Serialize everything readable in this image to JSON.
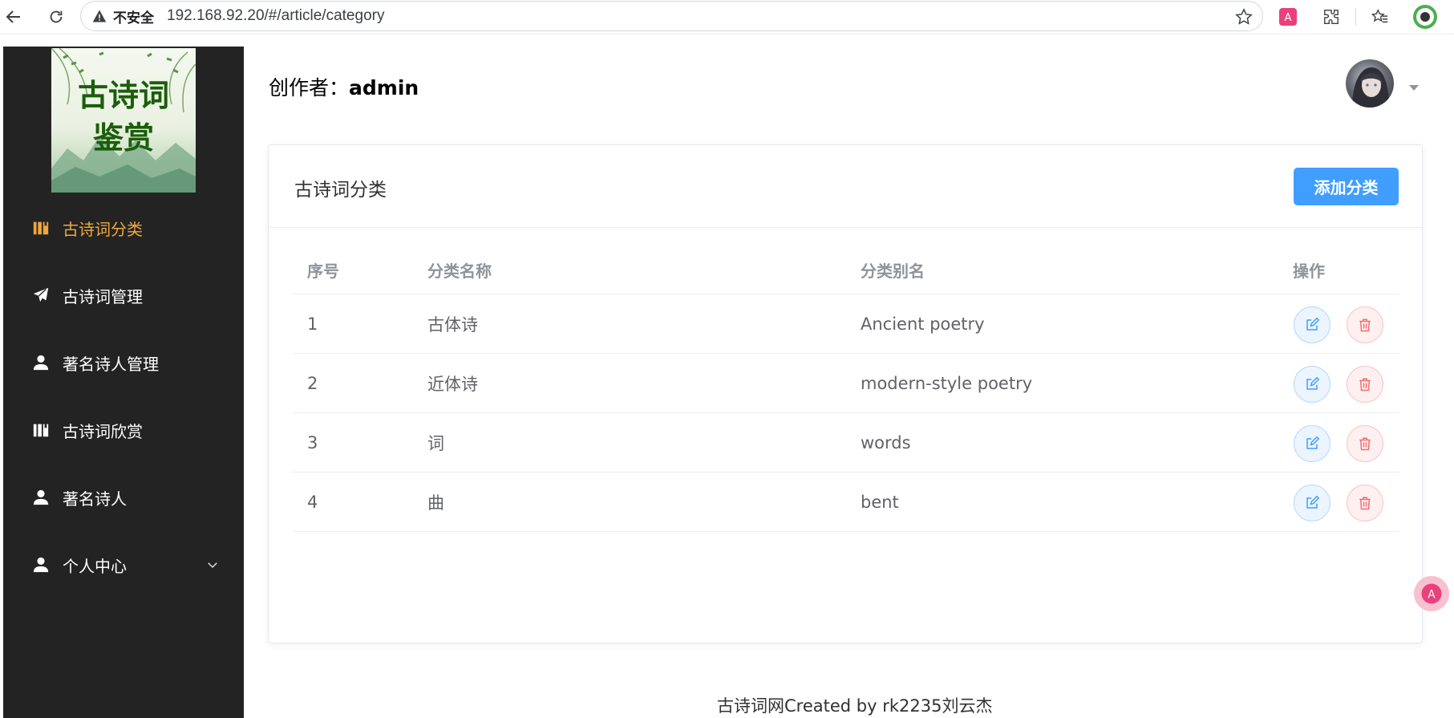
{
  "browser": {
    "insecure_label": "不安全",
    "url": "192.168.92.20/#/article/category"
  },
  "sidebar": {
    "logo_text": "古诗词鉴赏",
    "items": [
      {
        "label": "古诗词分类",
        "icon": "book-icon",
        "active": true
      },
      {
        "label": "古诗词管理",
        "icon": "paper-plane-icon"
      },
      {
        "label": "著名诗人管理",
        "icon": "user-icon"
      },
      {
        "label": "古诗词欣赏",
        "icon": "book-icon"
      },
      {
        "label": "著名诗人",
        "icon": "user-icon"
      },
      {
        "label": "个人中心",
        "icon": "user-icon",
        "has_submenu": true
      }
    ]
  },
  "header": {
    "creator_label": "创作者：",
    "creator_name": "admin"
  },
  "card": {
    "title": "古诗词分类",
    "add_button": "添加分类"
  },
  "table": {
    "columns": [
      "序号",
      "分类名称",
      "分类别名",
      "操作"
    ],
    "rows": [
      {
        "no": "1",
        "name": "古体诗",
        "alias": "Ancient poetry"
      },
      {
        "no": "2",
        "name": "近体诗",
        "alias": "modern-style poetry"
      },
      {
        "no": "3",
        "name": "词",
        "alias": "words"
      },
      {
        "no": "4",
        "name": "曲",
        "alias": "bent"
      }
    ]
  },
  "footer": {
    "text": "古诗词网Created by rk2235刘云杰"
  },
  "colors": {
    "primary": "#409eff",
    "danger": "#f56c6c",
    "sidebar_bg": "#232323",
    "active_menu": "#f0a83c"
  }
}
